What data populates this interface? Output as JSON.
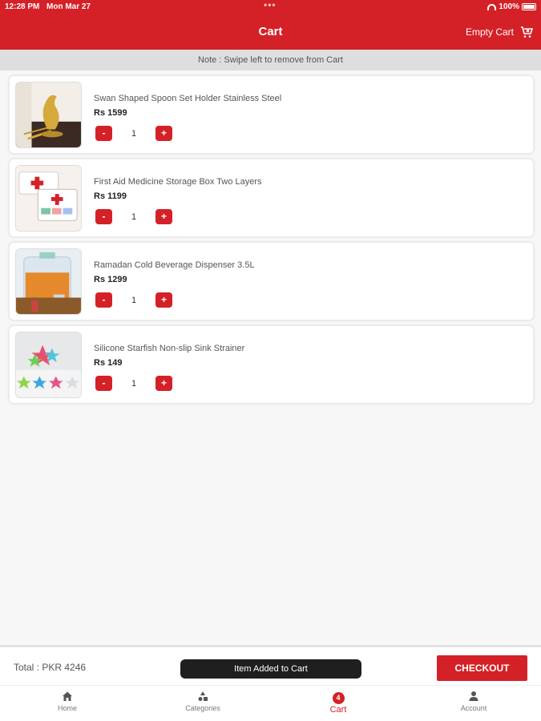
{
  "status_bar": {
    "time": "12:28 PM",
    "date": "Mon Mar 27",
    "battery": "100%"
  },
  "header": {
    "title": "Cart",
    "empty_cart_label": "Empty Cart"
  },
  "note": "Note : Swipe left to remove from Cart",
  "cart_items": [
    {
      "name": "Swan Shaped Spoon Set Holder Stainless Steel",
      "price": "Rs 1599",
      "quantity": "1",
      "minus": "-",
      "plus": "+"
    },
    {
      "name": "First Aid Medicine Storage Box Two Layers",
      "price": "Rs 1199",
      "quantity": "1",
      "minus": "-",
      "plus": "+"
    },
    {
      "name": "Ramadan Cold Beverage Dispenser 3.5L",
      "price": "Rs 1299",
      "quantity": "1",
      "minus": "-",
      "plus": "+"
    },
    {
      "name": "Silicone Starfish Non-slip Sink Strainer",
      "price": "Rs 149",
      "quantity": "1",
      "minus": "-",
      "plus": "+"
    }
  ],
  "footer": {
    "total": "Total : PKR 4246",
    "checkout_label": "CHECKOUT"
  },
  "toast": "Item Added to Cart",
  "bottom_nav": {
    "home": "Home",
    "categories": "Categories",
    "cart": "Cart",
    "cart_badge": "4",
    "account": "Account"
  },
  "colors": {
    "accent": "#d42127",
    "background": "#f7f7f7",
    "note_bar": "#dedede"
  }
}
